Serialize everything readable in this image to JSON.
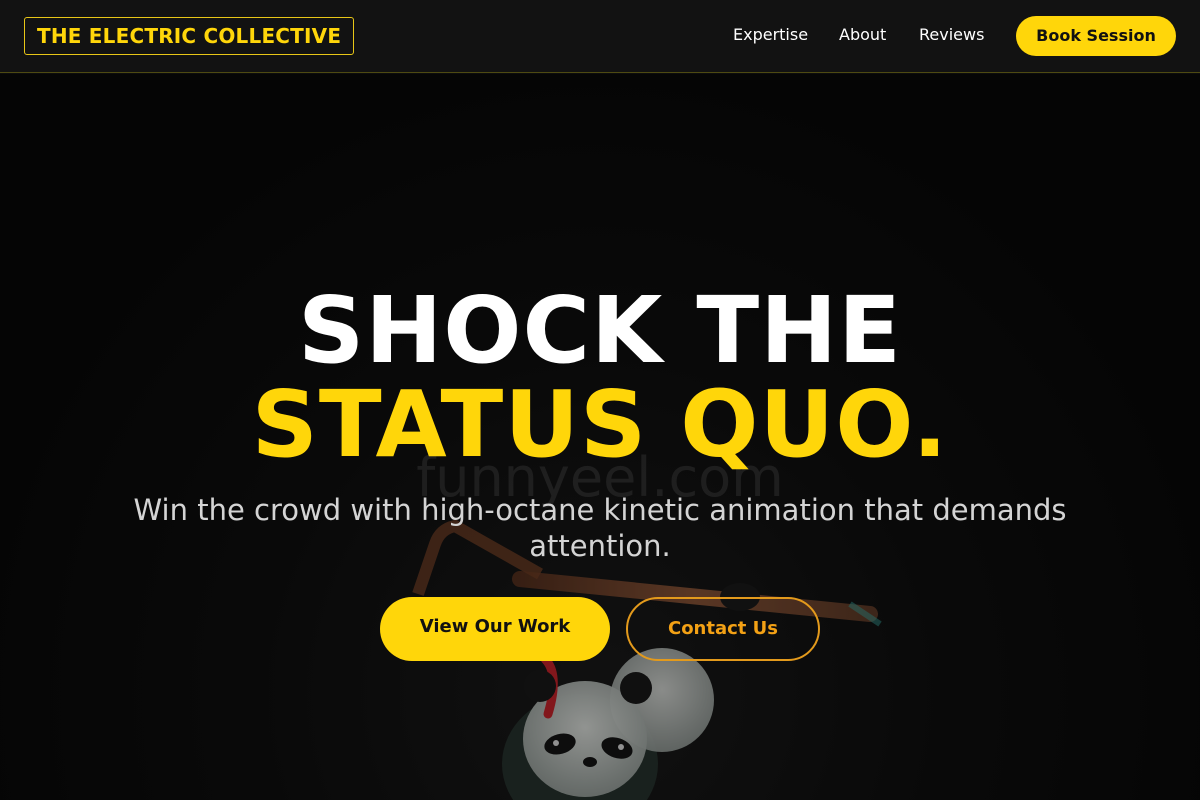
{
  "header": {
    "logo_text": "THE ELECTRIC COLLECTIVE",
    "nav": {
      "expertise": "Expertise",
      "about": "About",
      "reviews": "Reviews"
    },
    "cta_label": "Book Session"
  },
  "hero": {
    "headline_line1": "SHOCK THE",
    "headline_line2": "STATUS QUO.",
    "subtitle": "Win the crowd with high-octane kinetic animation that demands attention.",
    "primary_button": "View Our Work",
    "secondary_button": "Contact Us",
    "watermark": "funnyeel.com",
    "background_image_subject": "panda figurine holding a staff"
  },
  "colors": {
    "accent": "#ffd60a",
    "secondary_accent": "#f3a115",
    "background": "#0c0c0c",
    "header_background": "#121212",
    "text": "#ffffff",
    "subtitle_text": "#d4d4d4"
  }
}
